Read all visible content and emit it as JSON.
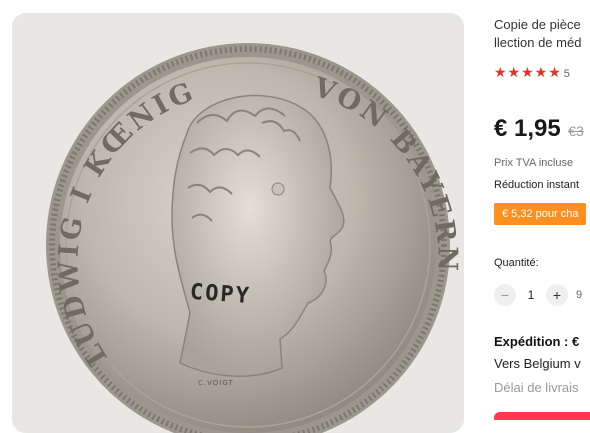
{
  "product": {
    "title": "Copie de pièce\nllection de méd"
  },
  "image": {
    "coin_legend": "LUDWIG I KŒNIG VON BAYERN",
    "stamp_text": "COPY",
    "engraver_text": "C.VOIGT"
  },
  "rating": {
    "stars": "★★★★★",
    "value": "5"
  },
  "price": {
    "current": "€ 1,95",
    "original": "€3"
  },
  "tva_text": "Prix TVA incluse",
  "reduction_text": "Réduction instant",
  "coupon_text": "€ 5,32 pour cha",
  "quantity": {
    "label": "Quantité:",
    "minus": "−",
    "value": "1",
    "plus": "+",
    "available": "9"
  },
  "shipping": {
    "title": "Expédition : €",
    "to": "Vers Belgium v",
    "delay": "Délai de livrais"
  },
  "colors": {
    "accent": "#e4312a",
    "coupon": "#ff8f1f",
    "buy_button": "#fd384f"
  }
}
